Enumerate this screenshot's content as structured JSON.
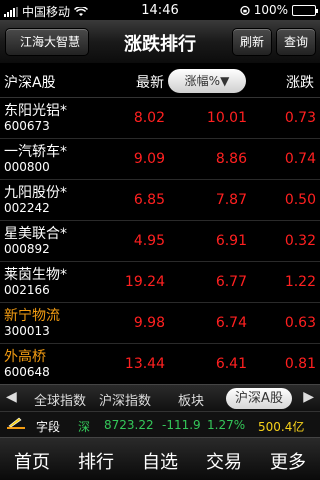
{
  "status_bar": {
    "carrier": "中国移动",
    "time": "14:46",
    "battery": "100%"
  },
  "nav": {
    "back": "江海大智慧",
    "title": "涨跌排行",
    "refresh": "刷新",
    "query": "查询"
  },
  "columns": {
    "name": "沪深A股",
    "latest": "最新",
    "change_pct": "涨幅%▼",
    "change": "涨跌"
  },
  "rows": [
    {
      "name": "东阳光铝*",
      "code": "600673",
      "latest": "8.02",
      "pct": "10.01",
      "chg": "0.73",
      "highlight": false
    },
    {
      "name": "一汽轿车*",
      "code": "000800",
      "latest": "9.09",
      "pct": "8.86",
      "chg": "0.74",
      "highlight": false
    },
    {
      "name": "九阳股份*",
      "code": "002242",
      "latest": "6.85",
      "pct": "7.87",
      "chg": "0.50",
      "highlight": false
    },
    {
      "name": "星美联合*",
      "code": "000892",
      "latest": "4.95",
      "pct": "6.91",
      "chg": "0.32",
      "highlight": false
    },
    {
      "name": "莱茵生物*",
      "code": "002166",
      "latest": "19.24",
      "pct": "6.77",
      "chg": "1.22",
      "highlight": false
    },
    {
      "name": "新宁物流",
      "code": "300013",
      "latest": "9.98",
      "pct": "6.74",
      "chg": "0.63",
      "highlight": true
    },
    {
      "name": "外高桥",
      "code": "600648",
      "latest": "13.44",
      "pct": "6.41",
      "chg": "0.81",
      "highlight": true
    }
  ],
  "tabs": {
    "global": "全球指数",
    "hs_index": "沪深指数",
    "sector": "板块",
    "hs_a": "沪深A股"
  },
  "ticker": {
    "label": "字段",
    "market": "深",
    "index": "8723.22",
    "change": "-111.9",
    "pct": "1.27%",
    "amount": "500.4亿"
  },
  "bottom_nav": {
    "home": "首页",
    "rank": "排行",
    "watch": "自选",
    "trade": "交易",
    "more": "更多"
  },
  "colors": {
    "up": "#ff2020",
    "orange": "#f39c12",
    "green": "#34c759",
    "yellow": "#f7d21b"
  }
}
